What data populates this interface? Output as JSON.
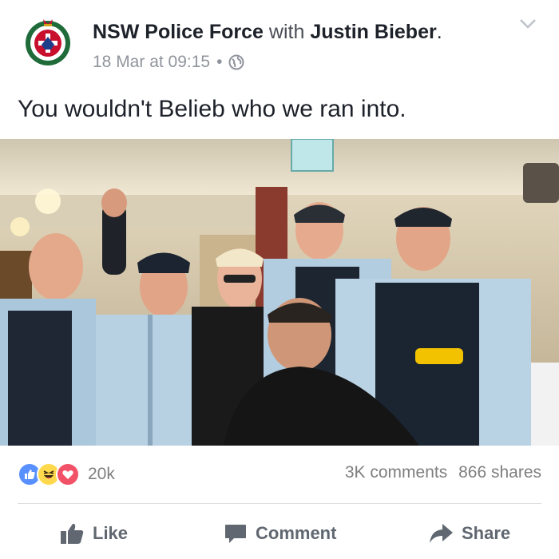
{
  "post": {
    "author": "NSW Police Force",
    "with_word": "with",
    "tagged": "Justin Bieber",
    "period": ".",
    "timestamp": "18 Mar at 09:15",
    "separator": "•",
    "privacy_icon": "globe-icon",
    "menu_icon": "chevron-down-icon",
    "message": "You wouldn't Belieb who we ran into."
  },
  "reactions": {
    "icons": [
      "like-reaction-icon",
      "haha-reaction-icon",
      "love-reaction-icon"
    ],
    "count": "20k"
  },
  "stats": {
    "comments": "3K comments",
    "shares": "866 shares"
  },
  "actions": {
    "like": "Like",
    "comment": "Comment",
    "share": "Share"
  },
  "colors": {
    "like_blue": "#5890ff",
    "haha_yellow": "#ffd94d",
    "love_red": "#f25268",
    "text_dark": "#1d2129",
    "text_muted": "#90949c",
    "action_grey": "#606770"
  }
}
